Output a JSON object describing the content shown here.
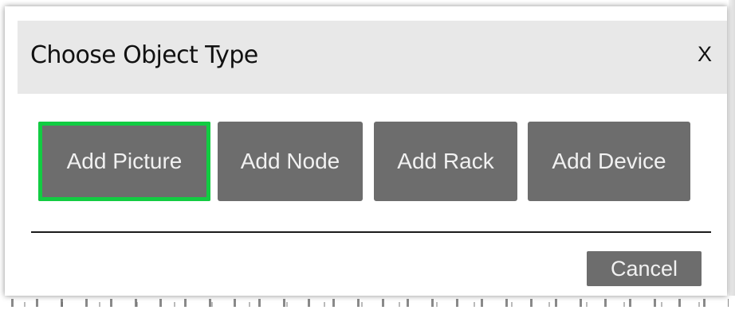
{
  "dialog": {
    "title": "Choose Object Type",
    "close_label": "X"
  },
  "object_types": [
    {
      "label": "Add Picture",
      "selected": true
    },
    {
      "label": "Add Node",
      "selected": false
    },
    {
      "label": "Add Rack",
      "selected": false
    },
    {
      "label": "Add Device",
      "selected": false
    }
  ],
  "footer": {
    "cancel_label": "Cancel"
  },
  "colors": {
    "header_background": "#e8e8e8",
    "button_background": "#6d6d6d",
    "button_text": "#f1f1f1",
    "selected_outline": "#12cc42"
  }
}
